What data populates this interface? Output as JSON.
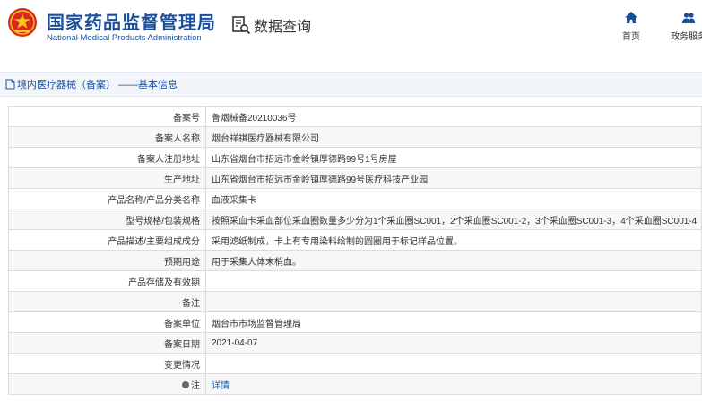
{
  "header": {
    "org_name_cn": "国家药品监督管理局",
    "org_name_en": "National Medical Products Administration",
    "page_title": "数据查询",
    "nav": [
      {
        "label": "首页",
        "icon": "home-icon"
      },
      {
        "label": "政务服务",
        "icon": "users-icon"
      }
    ]
  },
  "breadcrumb": "境内医疗器械（备案） ——基本信息",
  "colors": {
    "brand": "#1a4f9c",
    "logo_red": "#d7261f",
    "logo_gold": "#f5c519",
    "link": "#1a5fb4"
  },
  "detail": {
    "rows": [
      {
        "label": "备案号",
        "value": "鲁烟械备20210036号"
      },
      {
        "label": "备案人名称",
        "value": "烟台祥祺医疗器械有限公司"
      },
      {
        "label": "备案人注册地址",
        "value": "山东省烟台市招远市金岭镇厚德路99号1号房屋"
      },
      {
        "label": "生产地址",
        "value": "山东省烟台市招远市金岭镇厚德路99号医疗科技产业园"
      },
      {
        "label": "产品名称/产品分类名称",
        "value": "血液采集卡"
      },
      {
        "label": "型号规格/包装规格",
        "value": "按照采血卡采血部位采血圈数量多少分为1个采血圈SC001，2个采血圈SC001-2，3个采血圈SC001-3，4个采血圈SC001-4"
      },
      {
        "label": "产品描述/主要组成成分",
        "value": "采用滤纸制成，卡上有专用染料绘制的圆圈用于标记样品位置。"
      },
      {
        "label": "预期用途",
        "value": "用于采集人体末梢血。"
      },
      {
        "label": "产品存储及有效期",
        "value": ""
      },
      {
        "label": "备注",
        "value": ""
      },
      {
        "label": "备案单位",
        "value": "烟台市市场监督管理局"
      },
      {
        "label": "备案日期",
        "value": "2021-04-07"
      },
      {
        "label": "变更情况",
        "value": ""
      }
    ],
    "note_row": {
      "label": "注",
      "link": "详情"
    }
  }
}
